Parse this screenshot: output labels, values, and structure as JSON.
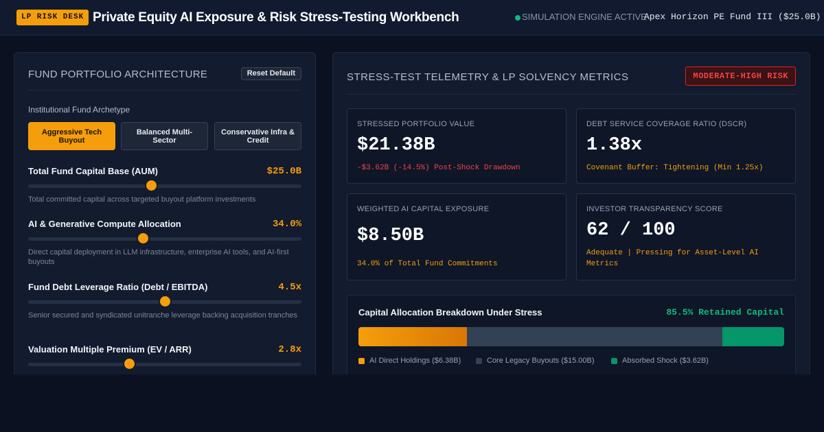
{
  "header": {
    "badge": "LP RISK DESK",
    "title": "Private Equity AI Exposure & Risk Stress-Testing Workbench",
    "status": "SIMULATION ENGINE ACTIVE",
    "fund": "Apex Horizon PE Fund III ($25.0B)"
  },
  "left": {
    "title": "FUND PORTFOLIO ARCHITECTURE",
    "reset_label": "Reset Default",
    "archetype_label": "Institutional Fund Archetype",
    "archetypes": [
      {
        "label": "Aggressive Tech Buyout",
        "active": true
      },
      {
        "label": "Balanced Multi-Sector",
        "active": false
      },
      {
        "label": "Conservative Infra & Credit",
        "active": false
      }
    ],
    "sliders": [
      {
        "label": "Total Fund Capital Base (AUM)",
        "value": "$25.0B",
        "level": 0.45,
        "desc": "Total committed capital across targeted buyout platform investments"
      },
      {
        "label": "AI & Generative Compute Allocation",
        "value": "34.0%",
        "level": 0.42,
        "desc": "Direct capital deployment in LLM infrastructure, enterprise AI tools, and AI-first buyouts"
      },
      {
        "label": "Fund Debt Leverage Ratio (Debt / EBITDA)",
        "value": "4.5x",
        "level": 0.5,
        "desc": "Senior secured and syndicated unitranche leverage backing acquisition tranches"
      },
      {
        "label": "Valuation Multiple Premium (EV / ARR)",
        "value": "2.8x",
        "level": 0.37,
        "desc": ""
      }
    ]
  },
  "right": {
    "title": "STRESS-TEST TELEMETRY & LP SOLVENCY METRICS",
    "risk_badge": "MODERATE-HIGH RISK",
    "metrics": [
      {
        "label": "STRESSED PORTFOLIO VALUE",
        "value": "$21.38B",
        "note": "-$3.62B (-14.5%) Post-Shock Drawdown",
        "tone": "red"
      },
      {
        "label": "DEBT SERVICE COVERAGE RATIO (DSCR)",
        "value": "1.38x",
        "note": "Covenant Buffer: Tightening (Min 1.25x)",
        "tone": "amber"
      },
      {
        "label": "WEIGHTED AI CAPITAL EXPOSURE",
        "value": "$8.50B",
        "note": "34.0% of Total Fund Commitments",
        "tone": "amber"
      },
      {
        "label": "INVESTOR TRANSPARENCY SCORE",
        "value": "62 / 100",
        "note": "Adequate | Pressing for Asset-Level AI Metrics",
        "tone": "amber"
      }
    ],
    "allocation": {
      "title": "Capital Allocation Breakdown Under Stress",
      "retained": "85.5% Retained Capital",
      "segments": [
        {
          "label": "AI Direct Holdings ($6.38B)",
          "amount": 6.38,
          "color": "#f59e0b",
          "color2": "#d97706"
        },
        {
          "label": "Core Legacy Buyouts ($15.00B)",
          "amount": 15.0,
          "color": "#334155",
          "color2": "#334155"
        },
        {
          "label": "Absorbed Shock ($3.62B)",
          "amount": 3.62,
          "color": "#059669",
          "color2": "#059669"
        }
      ]
    }
  }
}
